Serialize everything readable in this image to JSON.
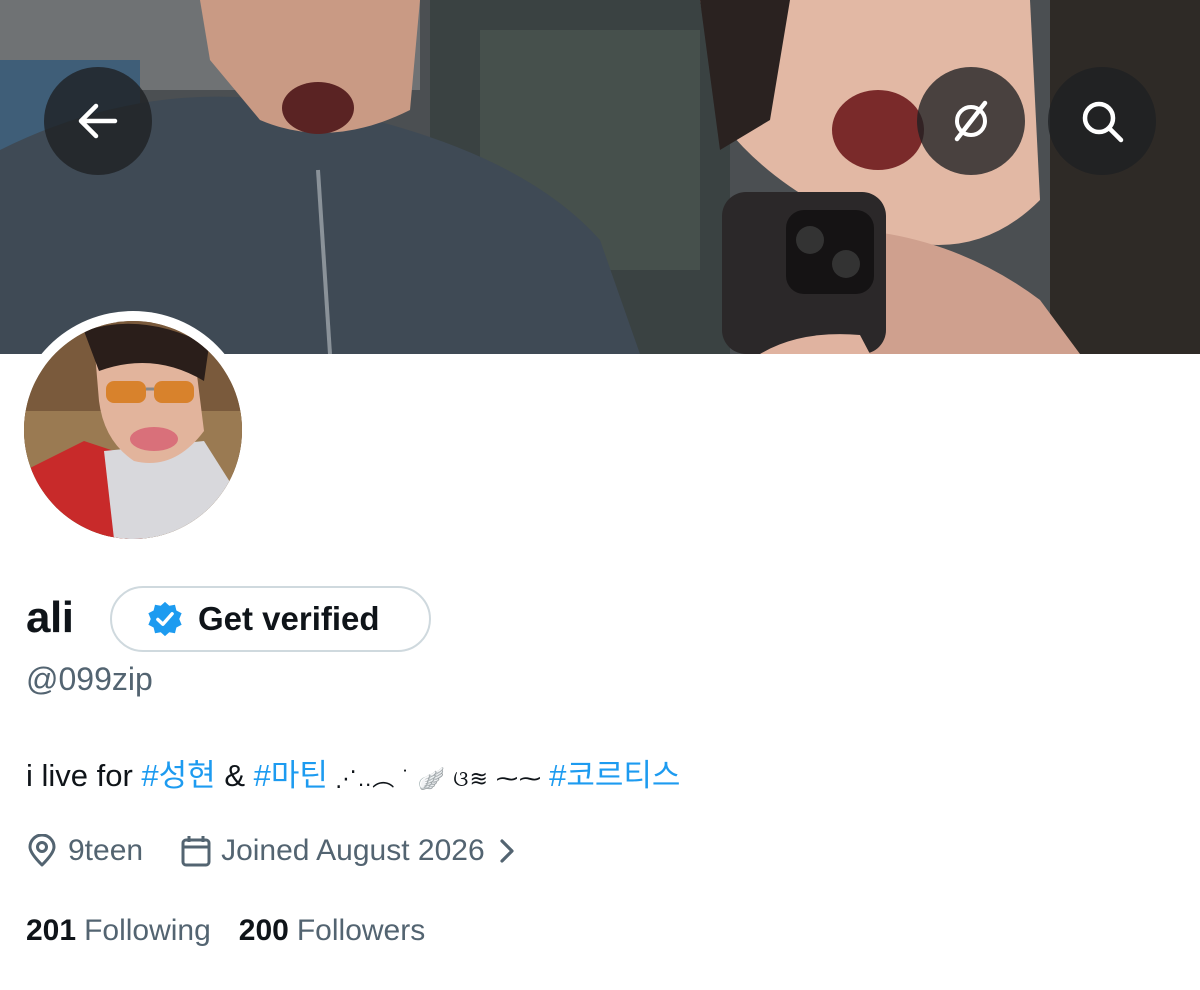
{
  "header": {
    "back_icon": "arrow-left-icon",
    "grok_icon": "grok-icon",
    "search_icon": "search-icon"
  },
  "profile": {
    "name": "ali",
    "verify_label": "Get verified",
    "handle": "@099zip",
    "bio": {
      "prefix": "i live for ",
      "tag1": "#성현",
      "mid": " & ",
      "tag2": "#마틴",
      "deco": " ⋰..︵ ˙ 🪽 ଓ≋ ⁓⁓ ",
      "tag3": "#코르티스"
    },
    "location": "9teen",
    "joined": "Joined August 2026",
    "following_count": "201",
    "following_label": "Following",
    "followers_count": "200",
    "followers_label": "Followers"
  },
  "colors": {
    "accent": "#1d9bf0",
    "muted": "#536471",
    "text": "#0f1419",
    "border": "#cfd9de"
  }
}
